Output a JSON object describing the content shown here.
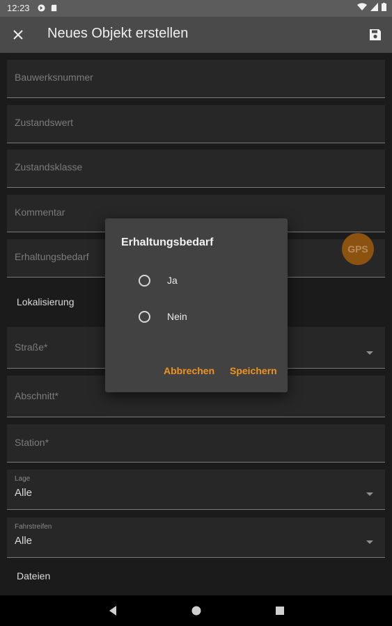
{
  "status": {
    "time": "12:23"
  },
  "app_bar": {
    "title": "Neues Objekt erstellen"
  },
  "form": {
    "bauwerksnummer": {
      "placeholder": "Bauwerksnummer"
    },
    "zustandswert": {
      "placeholder": "Zustandswert"
    },
    "zustandsklasse": {
      "placeholder": "Zustandsklasse"
    },
    "kommentar": {
      "placeholder": "Kommentar"
    },
    "erhaltungsbedarf": {
      "placeholder": "Erhaltungsbedarf"
    },
    "lokalisierung_label": "Lokalisierung",
    "gps_label": "GPS",
    "strasse": {
      "placeholder": "Straße*"
    },
    "abschnitt": {
      "placeholder": "Abschnitt*"
    },
    "station": {
      "placeholder": "Station*"
    },
    "lage": {
      "label": "Lage",
      "value": "Alle"
    },
    "fahrstreifen": {
      "label": "Fahrstreifen",
      "value": "Alle"
    },
    "dateien_label": "Dateien"
  },
  "dialog": {
    "title": "Erhaltungsbedarf",
    "options": [
      {
        "label": "Ja"
      },
      {
        "label": "Nein"
      }
    ],
    "cancel_label": "Abbrechen",
    "save_label": "Speichern"
  },
  "colors": {
    "accent": "#f0931e",
    "gps_button": "#8c5210",
    "dialog_bg": "#424242",
    "app_bar_bg": "#4a4a4a"
  }
}
